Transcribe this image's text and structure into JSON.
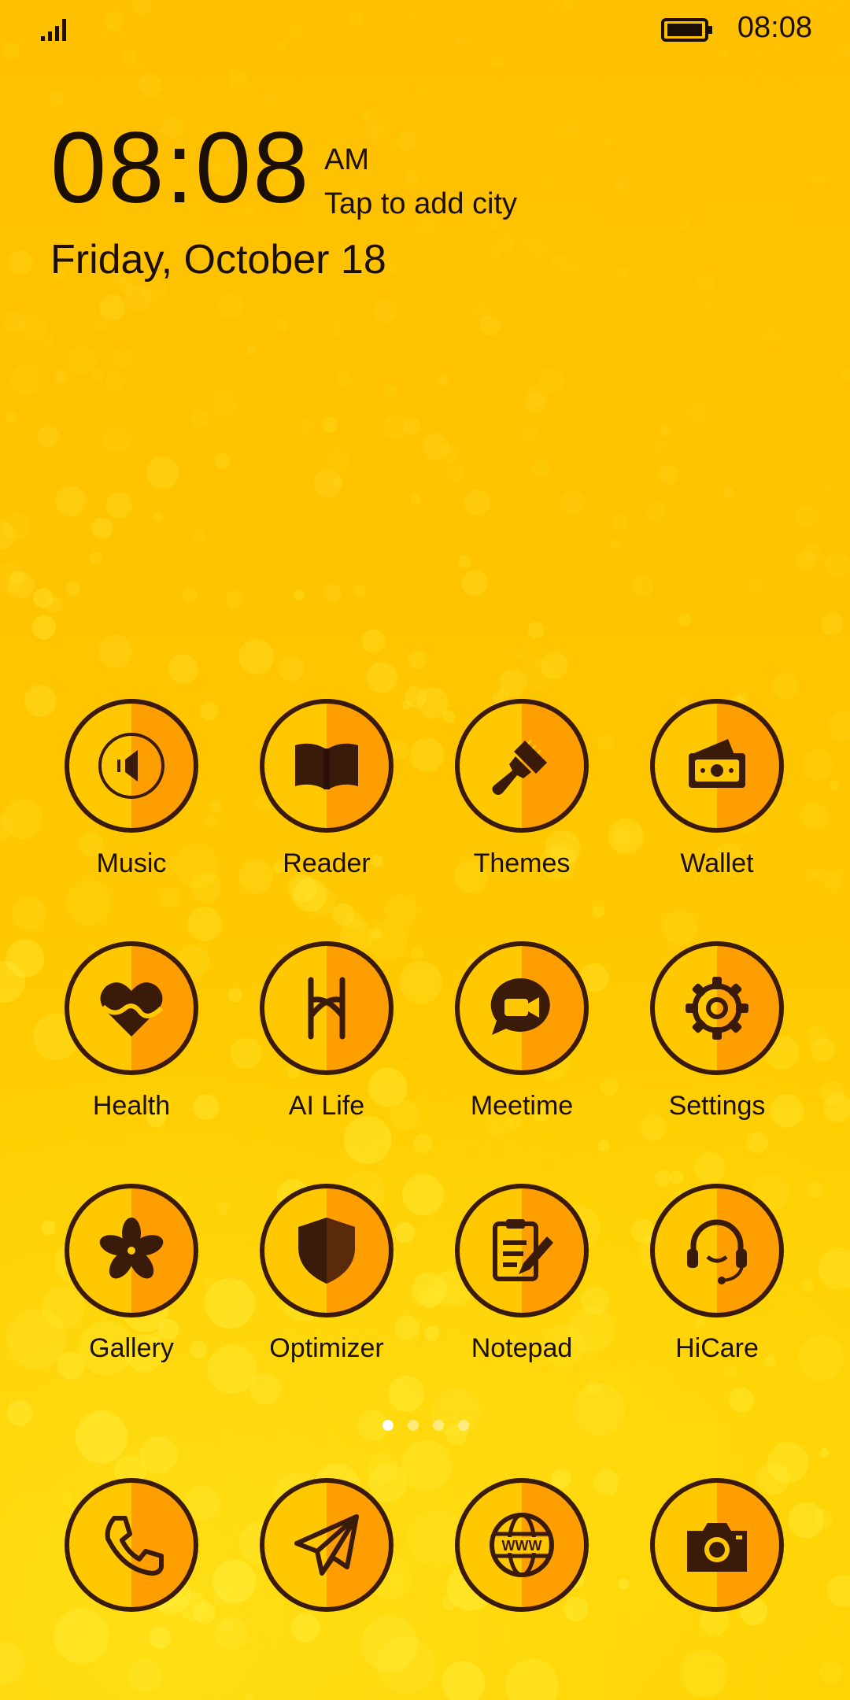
{
  "status_bar": {
    "time": "08:08",
    "icons": [
      "signal-icon",
      "battery-icon"
    ]
  },
  "clock_widget": {
    "time": "08:08",
    "ampm": "AM",
    "city_prompt": "Tap to add city",
    "date": "Friday, October 18"
  },
  "apps": [
    {
      "label": "Music",
      "icon": "music-icon"
    },
    {
      "label": "Reader",
      "icon": "book-icon"
    },
    {
      "label": "Themes",
      "icon": "brush-icon"
    },
    {
      "label": "Wallet",
      "icon": "wallet-icon"
    },
    {
      "label": "Health",
      "icon": "heart-icon"
    },
    {
      "label": "AI Life",
      "icon": "ai-life-icon"
    },
    {
      "label": "Meetime",
      "icon": "video-chat-icon"
    },
    {
      "label": "Settings",
      "icon": "gear-icon"
    },
    {
      "label": "Gallery",
      "icon": "flower-icon"
    },
    {
      "label": "Optimizer",
      "icon": "shield-icon"
    },
    {
      "label": "Notepad",
      "icon": "notepad-icon"
    },
    {
      "label": "HiCare",
      "icon": "headset-icon"
    }
  ],
  "page_indicator": {
    "pages": 4,
    "current": 1
  },
  "dock": [
    {
      "icon": "phone-icon"
    },
    {
      "icon": "paper-plane-icon"
    },
    {
      "icon": "globe-www-icon"
    },
    {
      "icon": "camera-icon"
    }
  ],
  "colors": {
    "background": "#FFC400",
    "icon_left": "#FFC800",
    "icon_right": "#FF9E00",
    "icon_stroke": "#3a1a08"
  }
}
